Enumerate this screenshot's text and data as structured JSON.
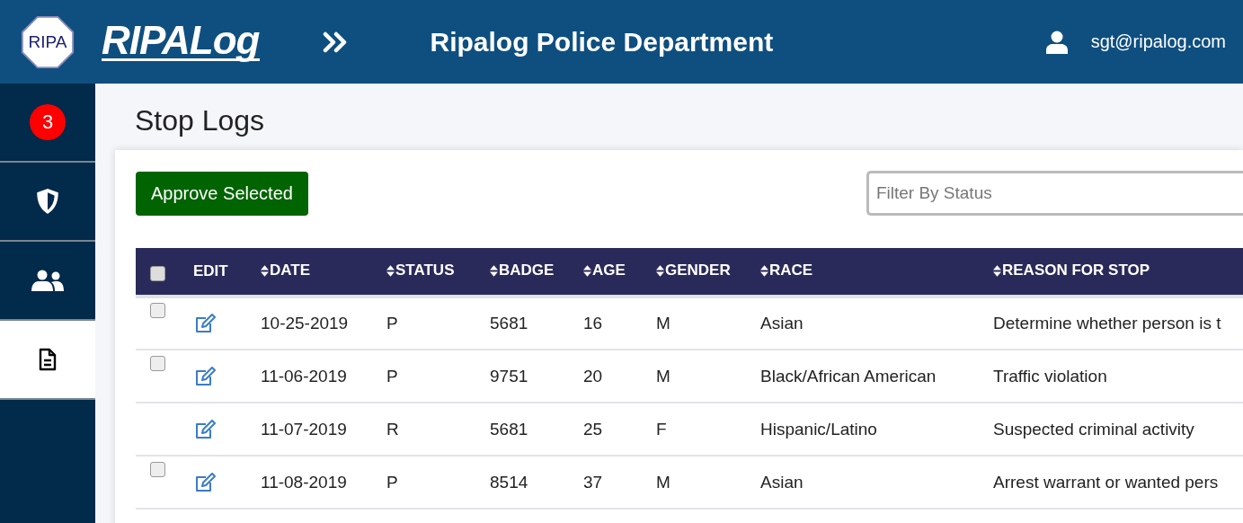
{
  "header": {
    "seal_text": "RIPA",
    "brand": "RIPALog",
    "title": "Ripalog Police Department",
    "user_email": "sgt@ripalog.com"
  },
  "sidebar": {
    "items": [
      {
        "kind": "badge",
        "badge": "3",
        "selected": false
      },
      {
        "kind": "shield",
        "selected": false
      },
      {
        "kind": "people",
        "selected": false
      },
      {
        "kind": "document",
        "selected": true
      }
    ]
  },
  "page_title": "Stop Logs",
  "toolbar": {
    "approve_button": "Approve Selected",
    "filter": {
      "placeholder": "Filter By Status"
    }
  },
  "table": {
    "select_all_checked": false,
    "edit_header": "EDIT",
    "columns": [
      {
        "label": "DATE"
      },
      {
        "label": "STATUS"
      },
      {
        "label": "BADGE"
      },
      {
        "label": "AGE"
      },
      {
        "label": "GENDER"
      },
      {
        "label": "RACE"
      },
      {
        "label": "REASON FOR STOP"
      }
    ],
    "rows": [
      {
        "selectable": true,
        "checked": false,
        "cells": [
          "10-25-2019",
          "P",
          "5681",
          "16",
          "M",
          "Asian",
          "Determine whether person is t"
        ]
      },
      {
        "selectable": true,
        "checked": false,
        "cells": [
          "11-06-2019",
          "P",
          "9751",
          "20",
          "M",
          "Black/African American",
          "Traffic violation"
        ]
      },
      {
        "selectable": false,
        "cells": [
          "11-07-2019",
          "R",
          "5681",
          "25",
          "F",
          "Hispanic/Latino",
          "Suspected criminal activity"
        ]
      },
      {
        "selectable": true,
        "checked": false,
        "cells": [
          "11-08-2019",
          "P",
          "8514",
          "37",
          "M",
          "Asian",
          "Arrest warrant or wanted pers"
        ]
      }
    ]
  }
}
